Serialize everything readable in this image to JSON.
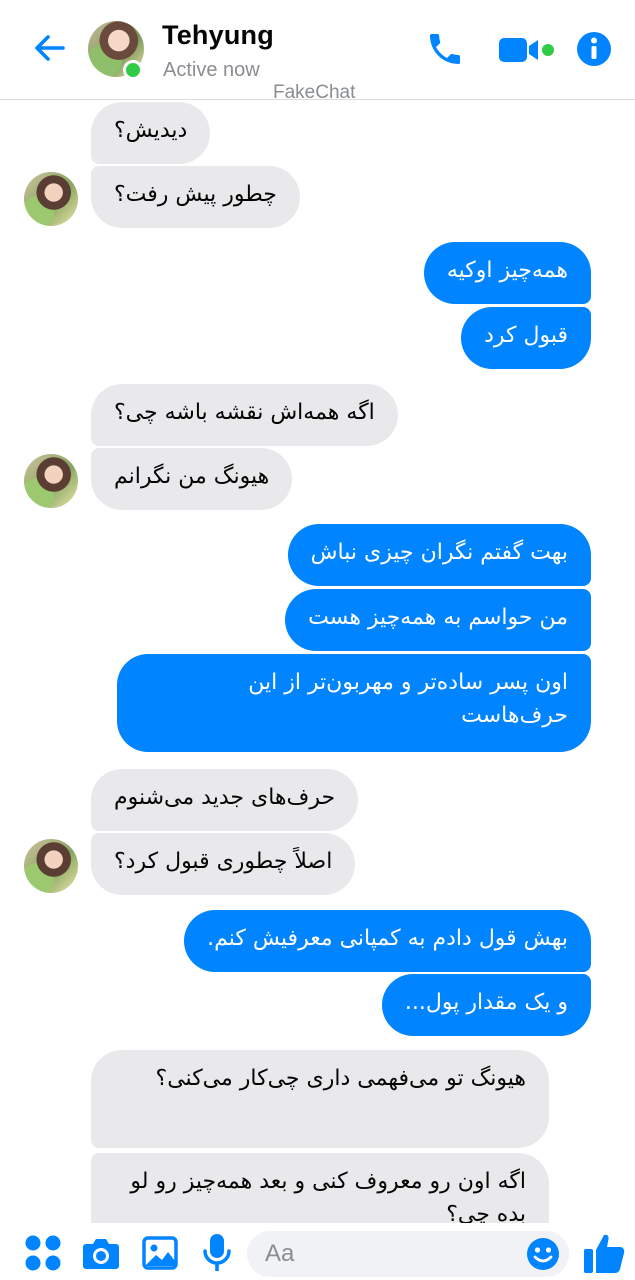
{
  "header": {
    "contact_name": "Tehyung",
    "status": "Active now",
    "watermark": "FakeChat"
  },
  "icons": {
    "back": "back-arrow-icon",
    "call": "phone-icon",
    "video": "video-camera-icon",
    "info": "info-icon",
    "menu": "four-dots-icon",
    "camera": "camera-icon",
    "gallery": "image-icon",
    "mic": "microphone-icon",
    "emoji": "smiley-icon",
    "like": "thumbs-up-icon"
  },
  "colors": {
    "accent": "#0084ff",
    "outgoing_bubble": "#0084ff",
    "incoming_bubble": "#e9e9eb",
    "online": "#31cc46"
  },
  "messages": [
    {
      "dir": "in",
      "text": "دیدیش؟"
    },
    {
      "dir": "in",
      "text": "چطور پیش رفت؟"
    },
    {
      "dir": "out",
      "text": "همه‌چیز اوکیه"
    },
    {
      "dir": "out",
      "text": "قبول کرد"
    },
    {
      "dir": "in",
      "text": "اگه همه‌اش نقشه باشه چی؟"
    },
    {
      "dir": "in",
      "text": "هیونگ من نگرانم"
    },
    {
      "dir": "out",
      "text": "بهت گفتم نگران چیزی نباش"
    },
    {
      "dir": "out",
      "text": "من حواسم به همه‌چیز هست"
    },
    {
      "dir": "out",
      "text": "اون پسر ساده‌تر و مهربون‌تر از این حرف‌هاست"
    },
    {
      "dir": "in",
      "text": "حرف‌های جدید می‌شنوم"
    },
    {
      "dir": "in",
      "text": "اصلاً چطوری قبول کرد؟"
    },
    {
      "dir": "out",
      "text": "بهش قول دادم به کمپانی معرفیش کنم."
    },
    {
      "dir": "out",
      "text": "و یک مقدار پول..."
    },
    {
      "dir": "in",
      "text": "هیونگ تو می‌فهمی داری چی‌کار می‌کنی؟"
    },
    {
      "dir": "in",
      "text": "اگه اون رو معروف کنی و بعد همه‌چیز رو لو بده چی؟"
    }
  ],
  "composer": {
    "placeholder": "Aa"
  }
}
